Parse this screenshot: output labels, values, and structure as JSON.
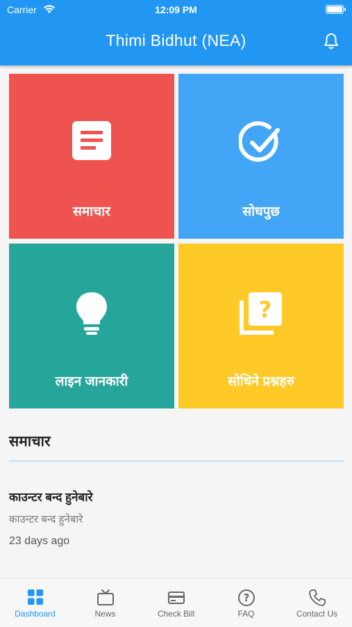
{
  "status_bar": {
    "carrier": "Carrier",
    "time": "12:09 PM"
  },
  "header": {
    "title": "Thimi Bidhut (NEA)",
    "icon": "bell-icon"
  },
  "tiles": [
    {
      "label": "समाचार",
      "icon": "news-document-icon",
      "color": "#ef5350"
    },
    {
      "label": "सोधपुछ",
      "icon": "check-circle-icon",
      "color": "#42a5f5"
    },
    {
      "label": "लाइन जानकारी",
      "icon": "lightbulb-icon",
      "color": "#26a69a"
    },
    {
      "label": "सोधिने प्रश्नहरु",
      "icon": "question-cards-icon",
      "color": "#ffca28"
    }
  ],
  "news_section": {
    "heading": "समाचार",
    "items": [
      {
        "title": "काउन्टर बन्द हुनेबारे",
        "subtitle": "काउन्टर बन्द हुनेबारे",
        "time": "23 days ago"
      }
    ]
  },
  "bottom_nav": [
    {
      "label": "Dashboard",
      "icon": "dashboard-grid-icon",
      "active": true
    },
    {
      "label": "News",
      "icon": "tv-icon",
      "active": false
    },
    {
      "label": "Check Bill",
      "icon": "credit-card-icon",
      "active": false
    },
    {
      "label": "FAQ",
      "icon": "question-circle-icon",
      "active": false
    },
    {
      "label": "Contact Us",
      "icon": "phone-icon",
      "active": false
    }
  ],
  "colors": {
    "primary": "#2196f3",
    "active_nav": "#2196f3"
  }
}
